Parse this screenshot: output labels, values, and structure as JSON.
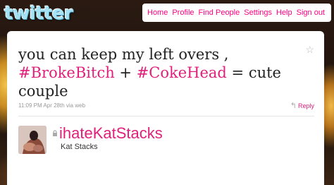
{
  "header": {
    "logo": "twitter",
    "nav": [
      "Home",
      "Profile",
      "Find People",
      "Settings",
      "Help",
      "Sign out"
    ]
  },
  "tweet": {
    "text_part1": "you can keep my left overs ,",
    "hashtag1": "#BrokeBitch",
    "plus": " + ",
    "hashtag2": "#CokeHead",
    "text_part2": " = cute couple",
    "timestamp": "11:09 PM Apr 28th via web",
    "reply_label": "Reply"
  },
  "author": {
    "username": "ihateKatStacks",
    "full_name": "Kat Stacks"
  },
  "icons": {
    "favorite": "star-icon",
    "reply": "reply-arrow-icon",
    "protected": "lock-icon"
  },
  "colors": {
    "accent": "#e0207a",
    "logo": "#a6e2f4"
  }
}
